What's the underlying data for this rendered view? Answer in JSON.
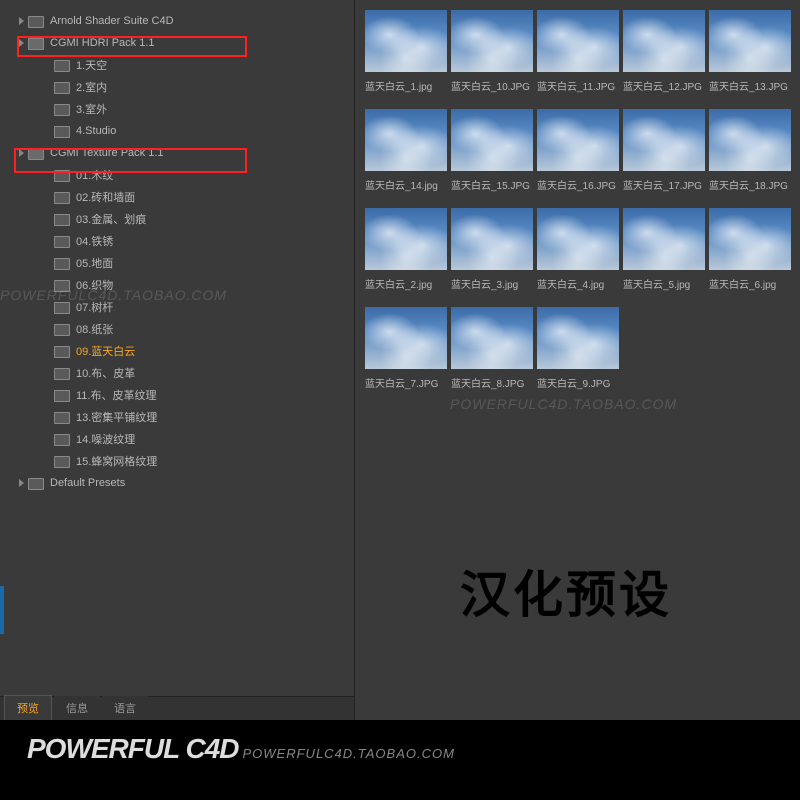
{
  "tree": {
    "items": [
      {
        "label": "Arnold Shader Suite C4D",
        "depth": 0,
        "arrow": true,
        "open": false
      },
      {
        "label": "CGMI HDRI Pack 1.1",
        "depth": 0,
        "arrow": true,
        "open": true
      },
      {
        "label": "1.天空",
        "depth": 1,
        "arrow": false
      },
      {
        "label": "2.室内",
        "depth": 1,
        "arrow": false
      },
      {
        "label": "3.室外",
        "depth": 1,
        "arrow": false
      },
      {
        "label": "4.Studio",
        "depth": 1,
        "arrow": false
      },
      {
        "label": "CGMI Texture Pack 1.1",
        "depth": 0,
        "arrow": true,
        "open": true
      },
      {
        "label": "01.木纹",
        "depth": 1,
        "arrow": false
      },
      {
        "label": "02.砖和墙面",
        "depth": 1,
        "arrow": false
      },
      {
        "label": "03.金属、划痕",
        "depth": 1,
        "arrow": false
      },
      {
        "label": "04.铁锈",
        "depth": 1,
        "arrow": false
      },
      {
        "label": "05.地面",
        "depth": 1,
        "arrow": false
      },
      {
        "label": "06.织物",
        "depth": 1,
        "arrow": false
      },
      {
        "label": "07.树杆",
        "depth": 1,
        "arrow": false
      },
      {
        "label": "08.纸张",
        "depth": 1,
        "arrow": false
      },
      {
        "label": "09.蓝天白云",
        "depth": 1,
        "arrow": false,
        "selected": true
      },
      {
        "label": "10.布、皮革",
        "depth": 1,
        "arrow": false
      },
      {
        "label": "11.布、皮革纹理",
        "depth": 1,
        "arrow": false
      },
      {
        "label": "13.密集平铺纹理",
        "depth": 1,
        "arrow": false
      },
      {
        "label": "14.噪波纹理",
        "depth": 1,
        "arrow": false
      },
      {
        "label": "15.蜂窝网格纹理",
        "depth": 1,
        "arrow": false
      },
      {
        "label": "Default Presets",
        "depth": 0,
        "arrow": true,
        "open": false
      }
    ]
  },
  "tabs": [
    {
      "label": "预览",
      "active": true
    },
    {
      "label": "信息",
      "active": false
    },
    {
      "label": "语言",
      "active": false
    }
  ],
  "thumbnails": [
    {
      "label": "蓝天白云_1.jpg"
    },
    {
      "label": "蓝天白云_10.JPG"
    },
    {
      "label": "蓝天白云_11.JPG"
    },
    {
      "label": "蓝天白云_12.JPG"
    },
    {
      "label": "蓝天白云_13.JPG"
    },
    {
      "label": "蓝天白云_14.jpg"
    },
    {
      "label": "蓝天白云_15.JPG"
    },
    {
      "label": "蓝天白云_16.JPG"
    },
    {
      "label": "蓝天白云_17.JPG"
    },
    {
      "label": "蓝天白云_18.JPG"
    },
    {
      "label": "蓝天白云_2.jpg"
    },
    {
      "label": "蓝天白云_3.jpg"
    },
    {
      "label": "蓝天白云_4.jpg"
    },
    {
      "label": "蓝天白云_5.jpg"
    },
    {
      "label": "蓝天白云_6.jpg"
    },
    {
      "label": "蓝天白云_7.JPG"
    },
    {
      "label": "蓝天白云_8.JPG"
    },
    {
      "label": "蓝天白云_9.JPG"
    }
  ],
  "watermark": "POWERFULC4D.TAOBAO.COM",
  "overlay": "汉化预设",
  "footer": {
    "big": "POWERFUL C4D",
    "small": "POWERFULC4D.TAOBAO.COM"
  }
}
